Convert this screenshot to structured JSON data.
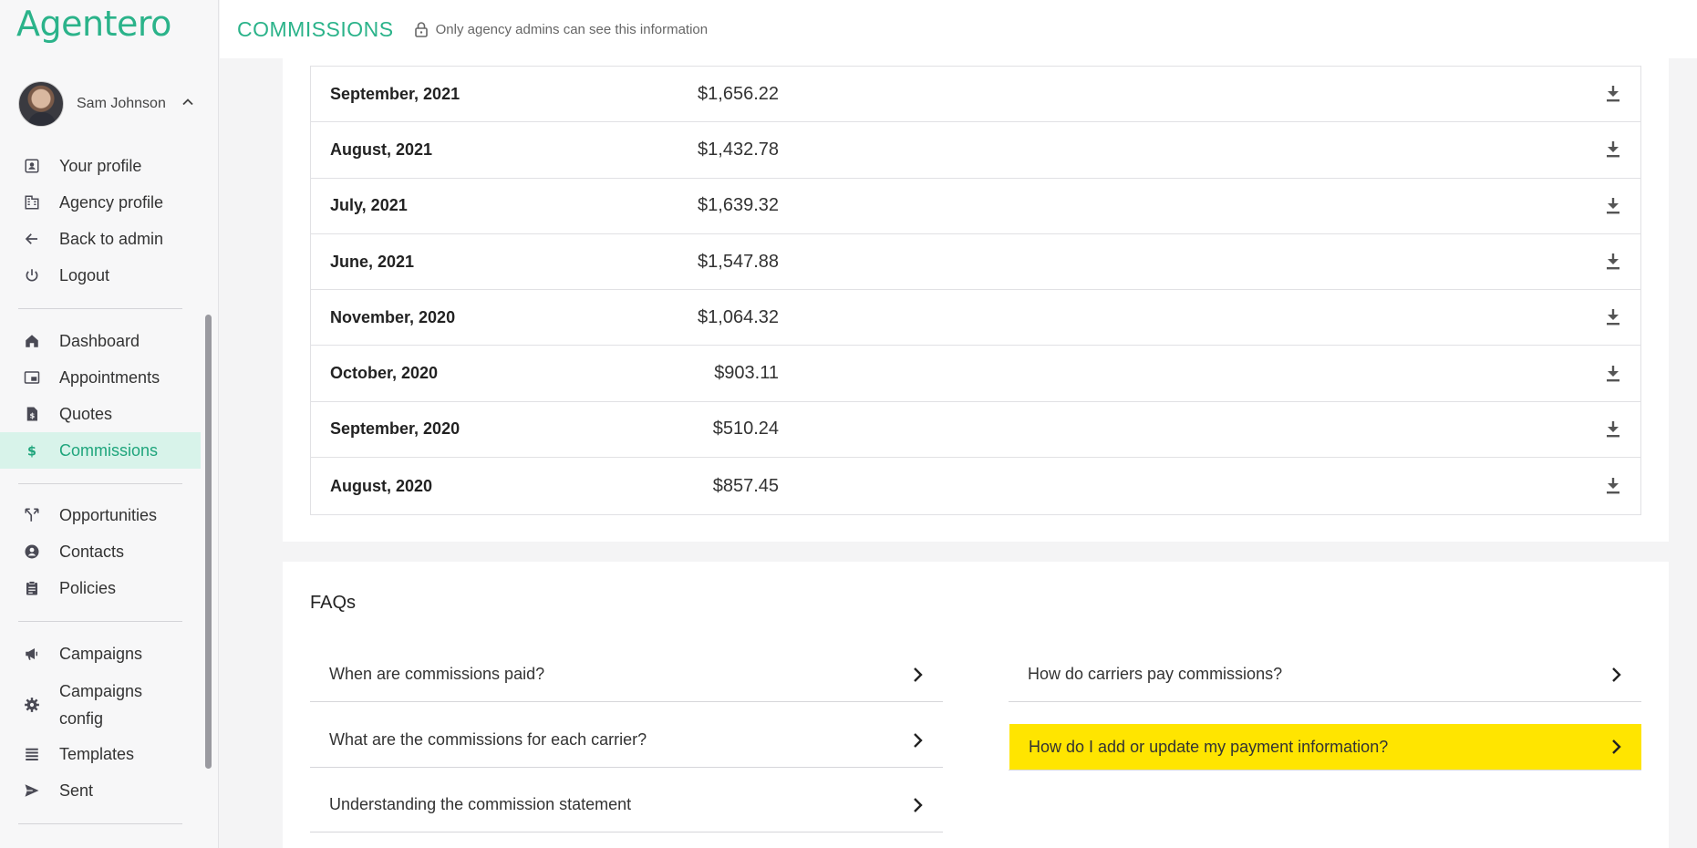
{
  "app": {
    "logo": "Agentero"
  },
  "header": {
    "title": "COMMISSIONS",
    "admin_note": "Only agency admins can see this information"
  },
  "user": {
    "name": "Sam Johnson"
  },
  "account_menu": [
    {
      "label": "Your profile",
      "icon": "profile-icon"
    },
    {
      "label": "Agency profile",
      "icon": "building-icon"
    },
    {
      "label": "Back to admin",
      "icon": "arrow-left-icon"
    },
    {
      "label": "Logout",
      "icon": "power-icon"
    }
  ],
  "nav": [
    {
      "label": "Dashboard",
      "icon": "home-icon"
    },
    {
      "label": "Appointments",
      "icon": "picture-in-picture-icon"
    },
    {
      "label": "Quotes",
      "icon": "quote-document-icon"
    },
    {
      "label": "Commissions",
      "icon": "dollar-icon",
      "active": true
    },
    {
      "label": "Opportunities",
      "icon": "merge-arrows-icon"
    },
    {
      "label": "Contacts",
      "icon": "contact-circle-icon"
    },
    {
      "label": "Policies",
      "icon": "clipboard-icon"
    },
    {
      "label": "Campaigns",
      "icon": "megaphone-icon"
    },
    {
      "label": "Campaigns config",
      "label_line1": "Campaigns",
      "label_line2": "config",
      "icon": "gear-icon"
    },
    {
      "label": "Templates",
      "icon": "list-icon"
    },
    {
      "label": "Sent",
      "icon": "send-icon"
    }
  ],
  "statements": [
    {
      "month": "September, 2021",
      "amount": "$1,656.22"
    },
    {
      "month": "August, 2021",
      "amount": "$1,432.78"
    },
    {
      "month": "July, 2021",
      "amount": "$1,639.32"
    },
    {
      "month": "June, 2021",
      "amount": "$1,547.88"
    },
    {
      "month": "November, 2020",
      "amount": "$1,064.32"
    },
    {
      "month": "October, 2020",
      "amount": "$903.11"
    },
    {
      "month": "September, 2020",
      "amount": "$510.24"
    },
    {
      "month": "August, 2020",
      "amount": "$857.45"
    }
  ],
  "faqs": {
    "title": "FAQs",
    "left": [
      "When are commissions paid?",
      "What are the commissions for each carrier?",
      "Understanding the commission statement"
    ],
    "right": [
      "How do carriers pay commissions?",
      "How do I add or update my payment information?"
    ]
  },
  "colors": {
    "brand": "#2bb38a",
    "active_bg": "#d8f3ea",
    "highlight": "#ffe500"
  }
}
